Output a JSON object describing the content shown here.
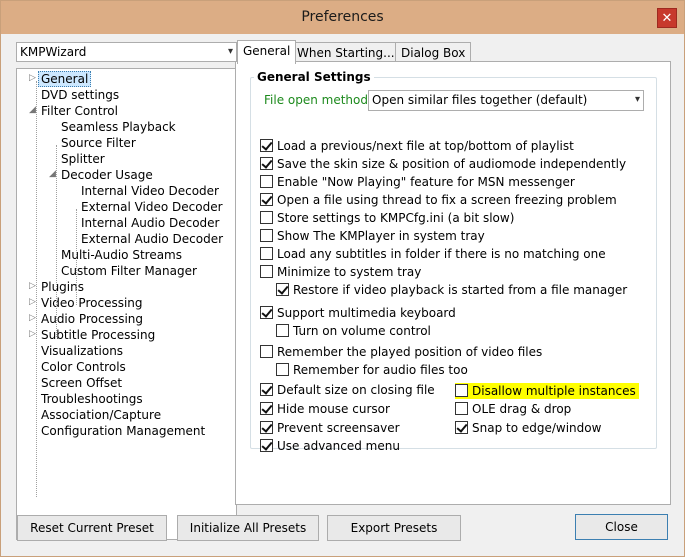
{
  "window": {
    "title": "Preferences"
  },
  "preset_combo": {
    "value": "KMPWizard"
  },
  "tree": {
    "items": [
      {
        "label": "General",
        "level": 0,
        "twist": "▷",
        "selected": true
      },
      {
        "label": "DVD settings",
        "level": 0,
        "twist": ""
      },
      {
        "label": "Filter Control",
        "level": 0,
        "twist": "◢"
      },
      {
        "label": "Seamless Playback",
        "level": 1,
        "twist": ""
      },
      {
        "label": "Source Filter",
        "level": 1,
        "twist": ""
      },
      {
        "label": "Splitter",
        "level": 1,
        "twist": ""
      },
      {
        "label": "Decoder Usage",
        "level": 1,
        "twist": "◢"
      },
      {
        "label": "Internal Video Decoder",
        "level": 2,
        "twist": ""
      },
      {
        "label": "External Video Decoder",
        "level": 2,
        "twist": ""
      },
      {
        "label": "Internal Audio Decoder",
        "level": 2,
        "twist": ""
      },
      {
        "label": "External Audio Decoder",
        "level": 2,
        "twist": ""
      },
      {
        "label": "Multi-Audio Streams",
        "level": 1,
        "twist": ""
      },
      {
        "label": "Custom Filter Manager",
        "level": 1,
        "twist": ""
      },
      {
        "label": "Plugins",
        "level": 0,
        "twist": "▷"
      },
      {
        "label": "Video Processing",
        "level": 0,
        "twist": "▷"
      },
      {
        "label": "Audio Processing",
        "level": 0,
        "twist": "▷"
      },
      {
        "label": "Subtitle Processing",
        "level": 0,
        "twist": "▷"
      },
      {
        "label": "Visualizations",
        "level": 0,
        "twist": ""
      },
      {
        "label": "Color Controls",
        "level": 0,
        "twist": ""
      },
      {
        "label": "Screen Offset",
        "level": 0,
        "twist": ""
      },
      {
        "label": "Troubleshootings",
        "level": 0,
        "twist": ""
      },
      {
        "label": "Association/Capture",
        "level": 0,
        "twist": ""
      },
      {
        "label": "Configuration Management",
        "level": 0,
        "twist": ""
      }
    ]
  },
  "tabs": [
    {
      "label": "General",
      "active": true
    },
    {
      "label": "When Starting...",
      "active": false
    },
    {
      "label": "Dialog Box",
      "active": false
    }
  ],
  "general_settings": {
    "title": "General Settings",
    "file_open_method_label": "File open method:",
    "file_open_method_value": "Open similar files together (default)",
    "options": [
      {
        "label": "Load a previous/next file at top/bottom of playlist",
        "checked": true
      },
      {
        "label": "Save the skin size & position of audiomode independently",
        "checked": true
      },
      {
        "label": "Enable \"Now Playing\" feature for MSN messenger",
        "checked": false
      },
      {
        "label": "Open a file using thread to fix a screen freezing problem",
        "checked": true
      },
      {
        "label": "Store settings to KMPCfg.ini (a bit slow)",
        "checked": false
      },
      {
        "label": "Show The KMPlayer in system tray",
        "checked": false
      },
      {
        "label": "Load any subtitles in folder if there is no matching one",
        "checked": false
      },
      {
        "label": "Minimize to system tray",
        "checked": false
      },
      {
        "label": "Restore if video playback is started from a file manager",
        "checked": true
      },
      {
        "label": "Support multimedia keyboard",
        "checked": true
      },
      {
        "label": "Turn on volume control",
        "checked": false
      },
      {
        "label": "Remember the played position of video files",
        "checked": false
      },
      {
        "label": "Remember for audio files too",
        "checked": false
      },
      {
        "label": "Default size on closing file",
        "checked": true
      },
      {
        "label": "Disallow multiple instances",
        "checked": false,
        "highlight": true
      },
      {
        "label": "Hide mouse cursor",
        "checked": true
      },
      {
        "label": "OLE drag & drop",
        "checked": false
      },
      {
        "label": "Prevent screensaver",
        "checked": true
      },
      {
        "label": "Snap to edge/window",
        "checked": true
      },
      {
        "label": "Use advanced menu",
        "checked": true
      }
    ]
  },
  "buttons": {
    "reset": "Reset Current Preset",
    "initialize": "Initialize All Presets",
    "export": "Export Presets",
    "close": "Close"
  },
  "colors": {
    "highlight": "#ffff00",
    "option_label": "#1d8a1d",
    "titlebar": "#dcad85"
  }
}
